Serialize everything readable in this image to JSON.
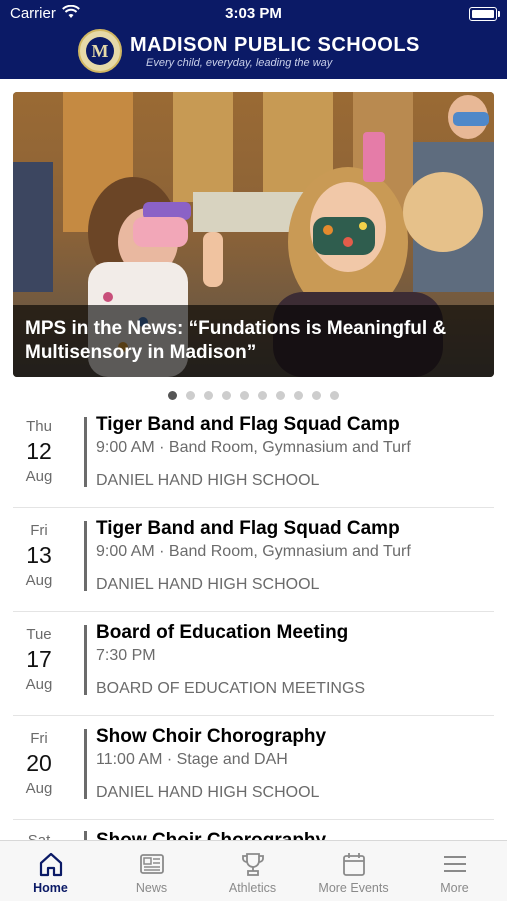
{
  "status_bar": {
    "carrier": "Carrier",
    "time": "3:03 PM"
  },
  "header": {
    "logo_letter": "M",
    "title": "MADISON PUBLIC SCHOOLS",
    "tagline": "Every child, everyday, leading the way"
  },
  "carousel": {
    "caption": "MPS in the News: “Fundations is Meaningful & Multisensory in Madison”",
    "page_count": 10,
    "active_page": 1
  },
  "events": [
    {
      "dow": "Thu",
      "day": "12",
      "month": "Aug",
      "title": "Tiger Band and Flag Squad Camp",
      "meta": "9:00 AM · Band Room, Gymnasium and Turf",
      "venue": "DANIEL HAND HIGH SCHOOL"
    },
    {
      "dow": "Fri",
      "day": "13",
      "month": "Aug",
      "title": "Tiger Band and Flag Squad Camp",
      "meta": "9:00 AM · Band Room, Gymnasium and Turf",
      "venue": "DANIEL HAND HIGH SCHOOL"
    },
    {
      "dow": "Tue",
      "day": "17",
      "month": "Aug",
      "title": "Board of Education Meeting",
      "meta": "7:30 PM",
      "venue": "BOARD OF EDUCATION MEETINGS"
    },
    {
      "dow": "Fri",
      "day": "20",
      "month": "Aug",
      "title": "Show Choir Chorography",
      "meta": "11:00 AM · Stage and DAH",
      "venue": "DANIEL HAND HIGH SCHOOL"
    }
  ],
  "partial_event": {
    "dow": "Sat",
    "title": "Show Choir Chorography"
  },
  "tabs": {
    "home": "Home",
    "news": "News",
    "athletics": "Athletics",
    "more_events": "More Events",
    "more": "More"
  },
  "colors": {
    "header_bg": "#0b1a66",
    "accent": "#0b1a66",
    "muted_text": "#6b6b6b"
  }
}
